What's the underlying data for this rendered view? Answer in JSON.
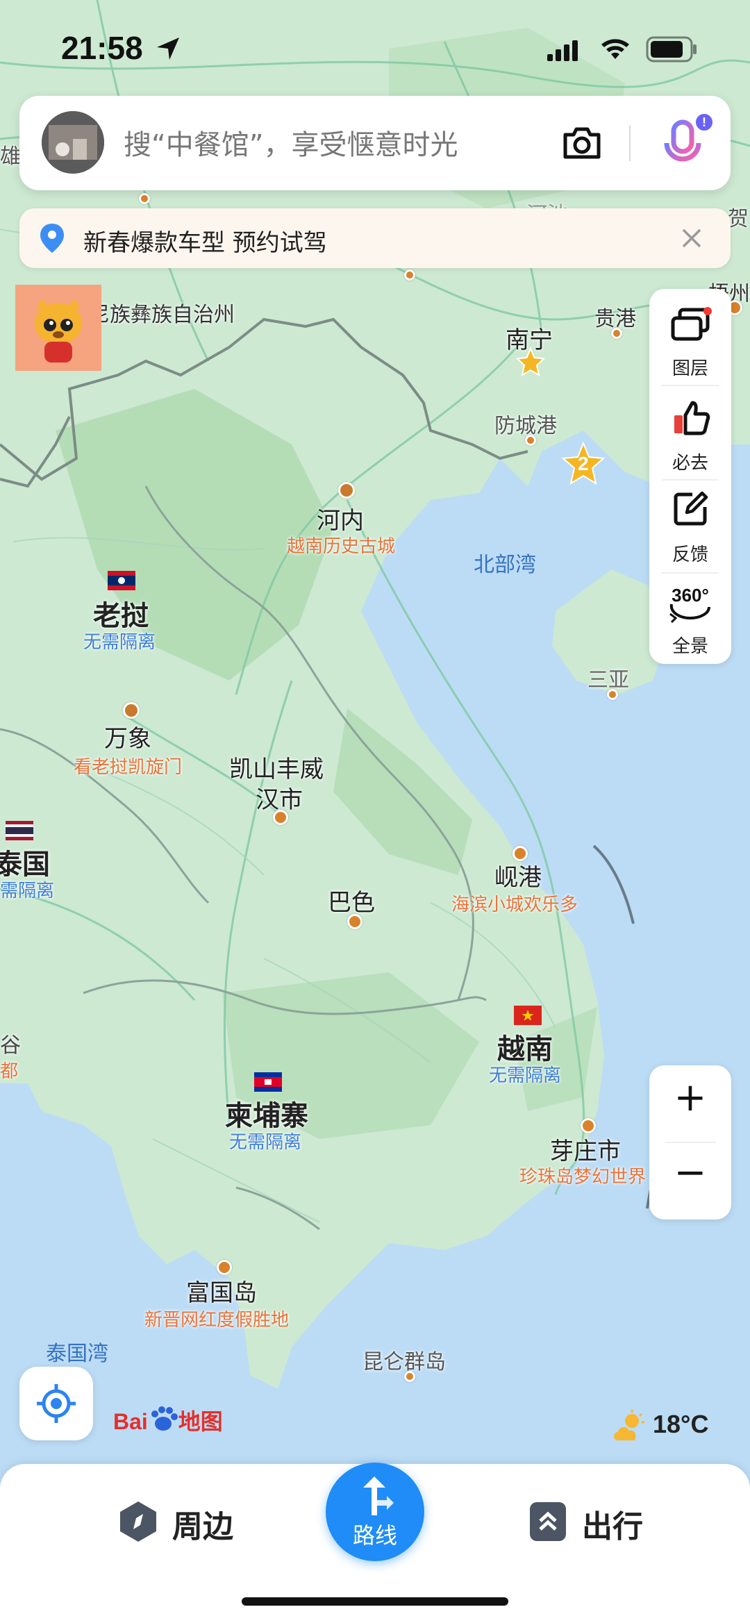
{
  "status_bar": {
    "time": "21:58"
  },
  "search": {
    "placeholder": "搜“中餐馆”，享受惬意时光"
  },
  "promo": {
    "text": "新春爆款车型 预约试驾"
  },
  "side_panel": {
    "items": [
      {
        "label": "图层",
        "icon": "layers-icon"
      },
      {
        "label": "必去",
        "icon": "thumbs-up-icon"
      },
      {
        "label": "反馈",
        "icon": "feedback-icon"
      },
      {
        "label": "全景",
        "icon": "panorama-360-icon",
        "badge": "360°"
      }
    ]
  },
  "zoom": {
    "in": "+",
    "out": "−"
  },
  "map": {
    "cities": {
      "nanning": "南宁",
      "guigang": "贵港",
      "fangchenggang": "防城港",
      "hanoi": "河内",
      "hanoi_sub": "越南历史古城",
      "vientiane": "万象",
      "vientiane_sub": "看老挝凯旋门",
      "savannakhet_1": "凯山丰威",
      "savannakhet_2": "汉市",
      "pakse": "巴色",
      "danang": "岘港",
      "danang_sub": "海滨小城欢乐多",
      "nhatrang": "芽庄市",
      "nhatrang_sub": "珍珠岛梦幻世界",
      "phuquoc": "富国岛",
      "phuquoc_sub": "新晋网红度假胜地",
      "condao": "昆仑群岛",
      "sanya": "三亚",
      "wuzhou": "梧州",
      "prefecture": "尼族彝族自治州",
      "heshan": "河池"
    },
    "countries": {
      "laos": "老挝",
      "laos_tip": "无需隔离",
      "thailand": "泰国",
      "thailand_tip": "需隔离",
      "vietnam": "越南",
      "vietnam_tip": "无需隔离",
      "cambodia": "柬埔寨",
      "cambodia_tip": "无需隔离"
    },
    "water": {
      "tonkin": "北部湾",
      "thai_gulf": "泰国湾"
    },
    "cluster_count": "2",
    "edge_left_1": "雄",
    "edge_left_2": "谷",
    "edge_left_3": "都",
    "edge_right": "贺"
  },
  "logo": {
    "text1": "Bai",
    "text2": "地图"
  },
  "weather": {
    "temp": "18°C"
  },
  "bottom_nav": {
    "nearby": "周边",
    "route": "路线",
    "travel": "出行"
  },
  "colors": {
    "accent": "#1f8cf7",
    "land": "#c9e8cf",
    "sea": "#bcdcf5",
    "tip": "#3d7fd6",
    "sub": "#e8743b"
  }
}
